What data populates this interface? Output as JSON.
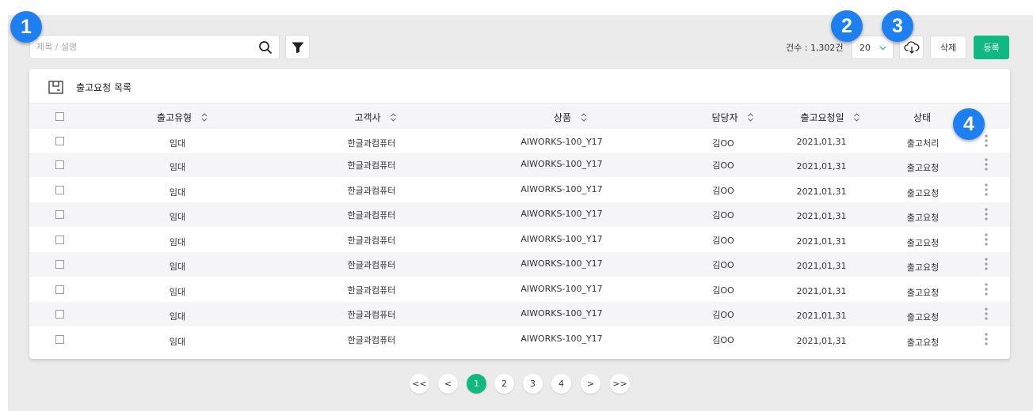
{
  "toolbar": {
    "search_placeholder": "제목 / 설명",
    "count_text": "건수 : 1,302건",
    "page_size": "20",
    "delete_label": "삭제",
    "register_label": "등록"
  },
  "markers": [
    "1",
    "2",
    "3",
    "4"
  ],
  "card": {
    "title": "출고요청 목록",
    "columns": [
      "출고유형",
      "고객사",
      "상품",
      "담당자",
      "출고요청일",
      "상태"
    ],
    "rows": [
      {
        "type": "임대",
        "customer": "한글과컴퓨터",
        "product": "AIWORKS-100_Y17",
        "manager": "김OO",
        "date": "2021,01,31",
        "status": "출고처리"
      },
      {
        "type": "임대",
        "customer": "한글과컴퓨터",
        "product": "AIWORKS-100_Y17",
        "manager": "김OO",
        "date": "2021,01,31",
        "status": "출고요청"
      },
      {
        "type": "임대",
        "customer": "한글과컴퓨터",
        "product": "AIWORKS-100_Y17",
        "manager": "김OO",
        "date": "2021,01,31",
        "status": "출고요청"
      },
      {
        "type": "임대",
        "customer": "한글과컴퓨터",
        "product": "AIWORKS-100_Y17",
        "manager": "김OO",
        "date": "2021,01,31",
        "status": "출고요청"
      },
      {
        "type": "임대",
        "customer": "한글과컴퓨터",
        "product": "AIWORKS-100_Y17",
        "manager": "김OO",
        "date": "2021,01,31",
        "status": "출고요청"
      },
      {
        "type": "임대",
        "customer": "한글과컴퓨터",
        "product": "AIWORKS-100_Y17",
        "manager": "김OO",
        "date": "2021,01,31",
        "status": "출고요청"
      },
      {
        "type": "임대",
        "customer": "한글과컴퓨터",
        "product": "AIWORKS-100_Y17",
        "manager": "김OO",
        "date": "2021,01,31",
        "status": "출고요청"
      },
      {
        "type": "임대",
        "customer": "한글과컴퓨터",
        "product": "AIWORKS-100_Y17",
        "manager": "김OO",
        "date": "2021,01,31",
        "status": "출고요청"
      },
      {
        "type": "임대",
        "customer": "한글과컴퓨터",
        "product": "AIWORKS-100_Y17",
        "manager": "김OO",
        "date": "2021,01,31",
        "status": "출고요청"
      }
    ]
  },
  "pagination": {
    "first": "<<",
    "prev": "<",
    "pages": [
      "1",
      "2",
      "3",
      "4"
    ],
    "current": "1",
    "next": ">",
    "last": ">>"
  },
  "colors": {
    "accent": "#10b981",
    "marker": "#1e7ff0",
    "background": "#ebebeb"
  }
}
